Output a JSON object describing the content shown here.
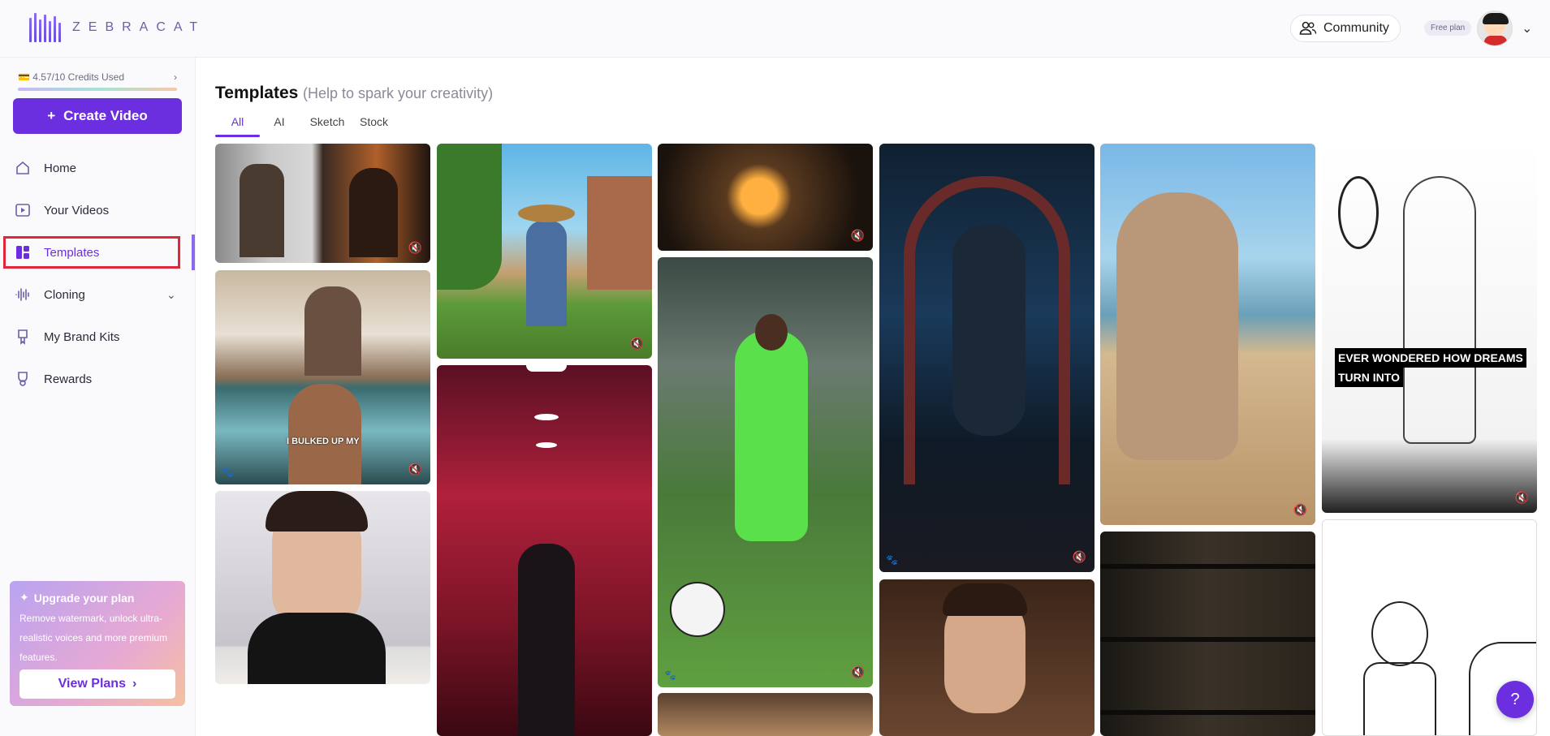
{
  "header": {
    "logo_text": "ZEBRACAT",
    "community_label": "Community",
    "plan_badge": "Free plan"
  },
  "sidebar": {
    "credits_text": "4.57/10 Credits Used",
    "credits_used_fraction": 0.457,
    "create_label": "Create Video",
    "items": [
      {
        "label": "Home",
        "icon": "home-icon"
      },
      {
        "label": "Your Videos",
        "icon": "video-icon"
      },
      {
        "label": "Templates",
        "icon": "templates-icon"
      },
      {
        "label": "Cloning",
        "icon": "waveform-icon"
      },
      {
        "label": "My Brand Kits",
        "icon": "brand-kit-icon"
      },
      {
        "label": "Rewards",
        "icon": "trophy-icon"
      }
    ],
    "upgrade": {
      "title": "Upgrade your plan",
      "body": "Remove watermark, unlock ultra-realistic voices and more premium features.",
      "cta": "View Plans"
    }
  },
  "main": {
    "title": "Templates",
    "subtitle": "(Help to spark your creativity)",
    "tabs": [
      "All",
      "AI",
      "Sketch",
      "Stock"
    ],
    "active_tab": "All",
    "captions": {
      "bulked": "I BULKED UP MY",
      "dreams_line1": "EVER WONDERED HOW DREAMS",
      "dreams_line2": "TURN INTO"
    }
  },
  "colors": {
    "brand": "#6b2fe0",
    "highlight": "#e0283a"
  }
}
